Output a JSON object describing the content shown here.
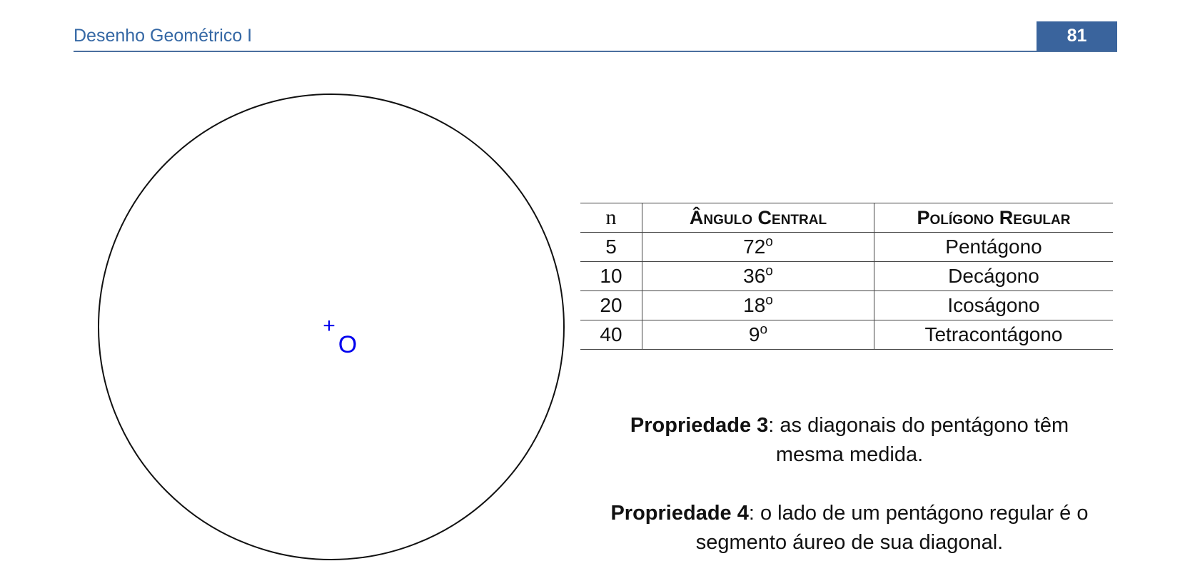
{
  "header": {
    "title": "Desenho Geométrico I",
    "page_number": "81"
  },
  "figure": {
    "center_label": "O",
    "center_mark": "+"
  },
  "table": {
    "headers": {
      "n": "n",
      "angle": "Ângulo Central",
      "polygon": "Polígono Regular"
    },
    "rows": [
      {
        "n": "5",
        "angle": "72",
        "polygon": "Pentágono"
      },
      {
        "n": "10",
        "angle": "36",
        "polygon": "Decágono"
      },
      {
        "n": "20",
        "angle": "18",
        "polygon": "Icoságono"
      },
      {
        "n": "40",
        "angle": "9",
        "polygon": "Tetracontágono"
      }
    ],
    "degree_symbol": "o"
  },
  "properties": {
    "p3": {
      "label": "Propriedade 3",
      "line1": ": as diagonais do pentágono têm",
      "line2": "mesma medida."
    },
    "p4": {
      "label": "Propriedade 4",
      "line1": ": o lado de um pentágono regular é o",
      "line2": "segmento áureo de sua diagonal."
    }
  }
}
